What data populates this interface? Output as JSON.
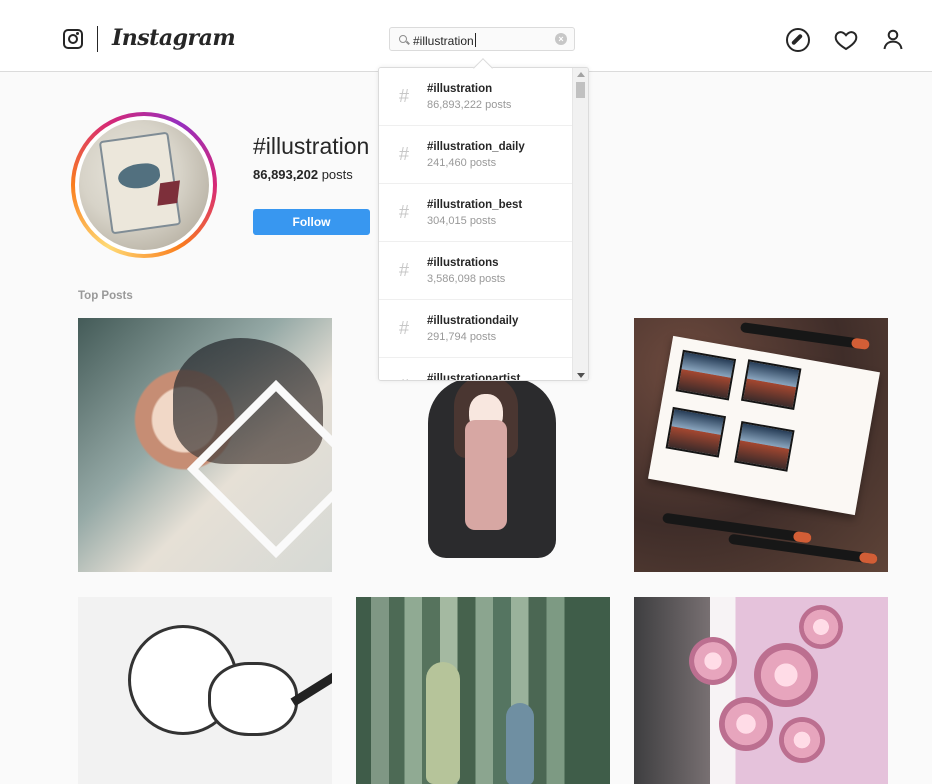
{
  "header": {
    "logo_icon": "camera-icon",
    "wordmark": "Instagram",
    "search": {
      "value": "#illustration",
      "clear_icon": "close-circle-icon",
      "icon": "search-icon"
    },
    "nav_icons": [
      "compass-icon",
      "heart-icon",
      "user-icon"
    ]
  },
  "search_results": [
    {
      "tag": "#illustration",
      "posts": "86,893,222 posts"
    },
    {
      "tag": "#illustration_daily",
      "posts": "241,460 posts"
    },
    {
      "tag": "#illustration_best",
      "posts": "304,015 posts"
    },
    {
      "tag": "#illustrations",
      "posts": "3,586,098 posts"
    },
    {
      "tag": "#illustrationdaily",
      "posts": "291,794 posts"
    },
    {
      "tag": "#illustrationartist",
      "posts": ""
    }
  ],
  "profile": {
    "title": "#illustration",
    "post_count": "86,893,202",
    "post_label": "posts",
    "follow_label": "Follow"
  },
  "top_posts": {
    "label": "Top Posts",
    "items": [
      "watercolor-portrait",
      "girl-in-black-coat",
      "mountain-sketchbook",
      "girl-and-pig-sketch",
      "forest-serpents",
      "purple-flower-bouquet"
    ]
  },
  "colors": {
    "accent": "#3897f0",
    "text": "#262626",
    "muted": "#999999",
    "border": "#dbdbdb"
  }
}
